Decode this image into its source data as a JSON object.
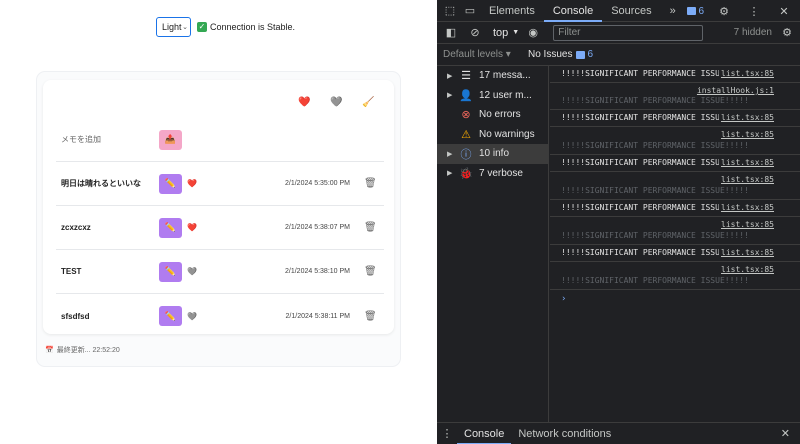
{
  "app": {
    "theme_value": "Light",
    "connection_text": "Connection is Stable.",
    "toolbar": {
      "heart": "❤️",
      "heart_gray": "🩶",
      "broom": "🧹"
    },
    "new_row": {
      "placeholder": "メモを追加",
      "button_icon": "📤"
    },
    "rows": [
      {
        "title": "明日は晴れるといいな",
        "fav": "❤️",
        "timestamp": "2/1/2024 5:35:00 PM"
      },
      {
        "title": "zcxzcxz",
        "fav": "❤️",
        "timestamp": "2/1/2024 5:38:07 PM"
      },
      {
        "title": "TEST",
        "fav": "🩶",
        "timestamp": "2/1/2024 5:38:10 PM"
      },
      {
        "title": "sfsdfsd",
        "fav": "🩶",
        "timestamp": "2/1/2024 5:38:11 PM"
      }
    ],
    "edit_icon": "✏️",
    "footer": {
      "icon": "📅",
      "text": "最終更新... 22:52:20"
    }
  },
  "devtools": {
    "tabs": [
      "Elements",
      "Console",
      "Sources"
    ],
    "active_tab": "Console",
    "more": "»",
    "badge_count": "6",
    "context": "top",
    "filter_placeholder": "Filter",
    "hidden": "7 hidden",
    "levels": "Default levels",
    "issues_label": "No Issues",
    "issues_count": "6",
    "sidebar": [
      {
        "label": "17 messa...",
        "icon": "☰"
      },
      {
        "label": "12 user m...",
        "icon": "👤"
      },
      {
        "label": "No errors",
        "icon": "⊗"
      },
      {
        "label": "No warnings",
        "icon": "⚠"
      },
      {
        "label": "10 info",
        "icon": "ⓘ"
      },
      {
        "label": "7 verbose",
        "icon": "🐞"
      }
    ],
    "messages": [
      {
        "text": "!!!!!SIGNIFICANT PERFORMANCE ISSUE!!!!!",
        "src": "list.tsx:85"
      },
      {
        "text": "!!!!!SIGNIFICANT PERFORMANCE ISSUE!!!!!",
        "src": "list.tsx:85",
        "hook": "installHook.js:1"
      },
      {
        "text": "!!!!!SIGNIFICANT PERFORMANCE ISSUE!!!!!",
        "src": "list.tsx:85"
      },
      {
        "text": "!!!!!SIGNIFICANT PERFORMANCE ISSUE!!!!!",
        "src": "list.tsx:85"
      },
      {
        "text": "!!!!!SIGNIFICANT PERFORMANCE ISSUE!!!!!",
        "src": "list.tsx:85"
      },
      {
        "text": "!!!!!SIGNIFICANT PERFORMANCE ISSUE!!!!!",
        "src": "list.tsx:85"
      },
      {
        "text": "!!!!!SIGNIFICANT PERFORMANCE ISSUE!!!!!",
        "src": "list.tsx:85"
      },
      {
        "text": "!!!!!SIGNIFICANT PERFORMANCE ISSUE!!!!!",
        "src": "list.tsx:85"
      },
      {
        "text": "!!!!!SIGNIFICANT PERFORMANCE ISSUE!!!!!",
        "src": "list.tsx:85"
      },
      {
        "text": "!!!!!SIGNIFICANT PERFORMANCE ISSUE!!!!!",
        "src": "list.tsx:85"
      }
    ],
    "drawer_tabs": [
      "Console",
      "Network conditions"
    ]
  }
}
